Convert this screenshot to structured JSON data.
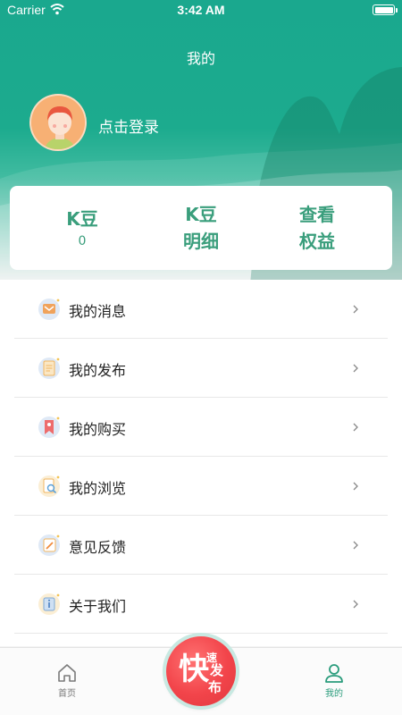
{
  "status_bar": {
    "carrier": "Carrier",
    "time": "3:42 AM"
  },
  "header": {
    "title": "我的",
    "login_text": "点击登录"
  },
  "stats": {
    "kdou": {
      "label": "K豆",
      "value": "0"
    },
    "kdou_detail": {
      "line1": "K豆",
      "line2": "明细"
    },
    "benefits": {
      "line1": "查看",
      "line2": "权益"
    }
  },
  "menu": {
    "items": [
      {
        "label": "我的消息",
        "icon": "message-icon"
      },
      {
        "label": "我的发布",
        "icon": "publish-icon"
      },
      {
        "label": "我的购买",
        "icon": "purchase-icon"
      },
      {
        "label": "我的浏览",
        "icon": "browse-icon"
      },
      {
        "label": "意见反馈",
        "icon": "feedback-icon"
      },
      {
        "label": "关于我们",
        "icon": "about-icon"
      }
    ]
  },
  "tabbar": {
    "home_label": "首页",
    "mine_label": "我的",
    "publish": {
      "main": "快",
      "chars": [
        "速",
        "发",
        "布"
      ]
    }
  },
  "colors": {
    "brand_green": "#1aa88e",
    "stat_green": "#3a9e7c",
    "fab_red": "#f2444a"
  }
}
